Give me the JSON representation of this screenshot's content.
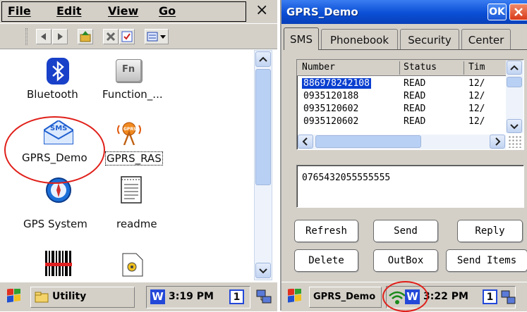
{
  "left": {
    "menu": [
      "File",
      "Edit",
      "View",
      "Go"
    ],
    "close_symbol": "×",
    "icons": [
      {
        "label": "Bluetooth",
        "glyph": "bluetooth-icon"
      },
      {
        "label": "Function_...",
        "glyph": "function-key-icon",
        "glyph_text": "Fn"
      },
      {
        "label": "GPRS_Demo",
        "glyph": "sms-envelope-icon",
        "glyph_text": "SMS"
      },
      {
        "label": "GPRS_RAS",
        "glyph": "gprs-antenna-icon",
        "glyph_text": "GPRS"
      },
      {
        "label": "GPS System",
        "glyph": "compass-icon"
      },
      {
        "label": "readme",
        "glyph": "document-icon"
      },
      {
        "label": "",
        "glyph": "barcode-icon"
      },
      {
        "label": "",
        "glyph": "settings-document-icon"
      }
    ],
    "taskbar": {
      "folder": "Utility",
      "time": "3:19 PM",
      "ime": "W",
      "num": "1"
    }
  },
  "right": {
    "title": "GPRS_Demo",
    "ok": "OK",
    "tabs": [
      "SMS",
      "Phonebook",
      "Security",
      "Center"
    ],
    "columns": [
      "Number",
      "Status",
      "Tim"
    ],
    "rows": [
      {
        "number": "886978242108",
        "status": "READ",
        "time": "12/"
      },
      {
        "number": "0935120188",
        "status": "READ",
        "time": "12/"
      },
      {
        "number": "0935120602",
        "status": "READ",
        "time": "12/"
      },
      {
        "number": "0935120602",
        "status": "READ",
        "time": "12/"
      }
    ],
    "message": "0765432055555555",
    "buttons": [
      "Refresh",
      "Send",
      "Reply",
      "Delete",
      "OutBox",
      "Send Items"
    ],
    "taskbar": {
      "app": "GPRS_Demo",
      "time": "3:22 PM",
      "ime": "W",
      "num": "1"
    }
  },
  "colors": {
    "title_bar": "#0a4fd6",
    "selection": "#0a3fd0",
    "annotation": "#e0201a",
    "scrollbar": "#b9d0f5"
  }
}
